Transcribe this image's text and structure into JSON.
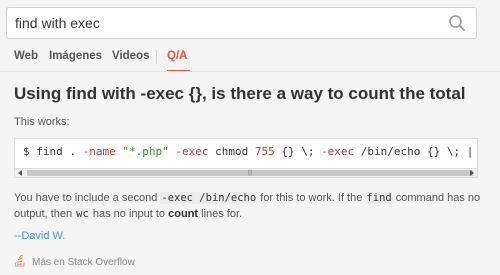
{
  "search": {
    "query": "find with exec"
  },
  "tabs": {
    "web": "Web",
    "images": "Imágenes",
    "videos": "Videos",
    "qa": "Q/A"
  },
  "answer": {
    "title": "Using find with -exec {}, is there a way to count the total",
    "intro": "This works:",
    "code": {
      "prompt": "$ find . ",
      "name_flag": "-name",
      "pattern": "\"*.php\"",
      "exec_flag": "-exec",
      "chmod": " chmod ",
      "mode": "755",
      "tail1": " {} \\; ",
      "exec_flag2": "-exec",
      "tail2": " /bin/echo {} \\; | wc"
    },
    "body": {
      "p1": "You have to include a second ",
      "code1": "-exec /bin/echo",
      "p2": " for this to work. If the ",
      "code2": "find",
      "p3": " command has no output, then ",
      "code3": "wc",
      "p4": " has no input to ",
      "bold1": "count",
      "p5": " lines for."
    },
    "author": "--David W."
  },
  "source": {
    "label": "Más en Stack Overflow"
  },
  "colors": {
    "accent": "#de5833",
    "link": "#4495d4",
    "background": "#f4f4f4"
  },
  "icons": {
    "search": "search-icon",
    "source": "stackoverflow-icon"
  }
}
